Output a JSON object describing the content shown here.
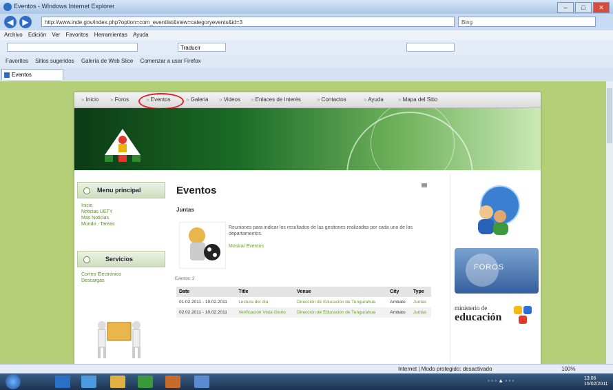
{
  "browser": {
    "window_title": "Eventos - Windows Internet Explorer",
    "url": "http://www.inde.gov/index.php?option=com_eventlist&view=categoryevents&id=3",
    "search_placeholder": "Bing",
    "menu": [
      "Archivo",
      "Edición",
      "Ver",
      "Favoritos",
      "Herramientas",
      "Ayuda"
    ],
    "translate_label": "Traducir",
    "favorites_bar": [
      "Favoritos",
      "Sitios sugeridos",
      "Galería de Web Slice",
      "Comenzar a usar Firefox"
    ],
    "tab_title": "Eventos",
    "status_text": "Internet | Modo protegido: desactivado",
    "zoom": "100%"
  },
  "site": {
    "nav": [
      "Inicio",
      "Foros",
      "Eventos",
      "Galeria",
      "Videos",
      "Enlaces de Interés",
      "Contactos",
      "Ayuda",
      "Mapa del Sitio"
    ],
    "sidebar": {
      "menu_title": "Menu principal",
      "menu_links": [
        "Inicio",
        "Noticias UETY",
        "Mas Noticias",
        "Mundo - Tareas"
      ],
      "services_title": "Servicios",
      "services_links": [
        "Correo Electrónico",
        "Descargas"
      ]
    },
    "main": {
      "title": "Eventos",
      "category": "Juntas",
      "description": "Reuniones para indicar los resultados de las gestiones realizadas por cada uno de los departamentos.",
      "more_link": "Mostrar Eventos",
      "icon_caption": "Eventos: 2",
      "table": {
        "headers": [
          "Date",
          "Title",
          "Venue",
          "City",
          "Type"
        ],
        "rows": [
          [
            "01.02.2011 - 10.02.2011",
            "Lectura del día",
            "Dirección de Educación de Tungurahua",
            "Ambato",
            "Juntas"
          ],
          [
            "02.02.2011 - 10.02.2011",
            "Verificación Vista Glorio",
            "Dirección de Educación de Tungurahua",
            "Ambato",
            "Juntas"
          ]
        ]
      }
    },
    "right": {
      "foros_label": "FOROS",
      "edu_line1": "ministerio de",
      "edu_line2": "educación"
    }
  },
  "taskbar": {
    "clock_time": "13:06",
    "clock_date": "15/02/2011"
  },
  "colors": {
    "green_bg": "#b4cf78",
    "link_green": "#6a9b30",
    "highlight_red": "#dd2222"
  }
}
